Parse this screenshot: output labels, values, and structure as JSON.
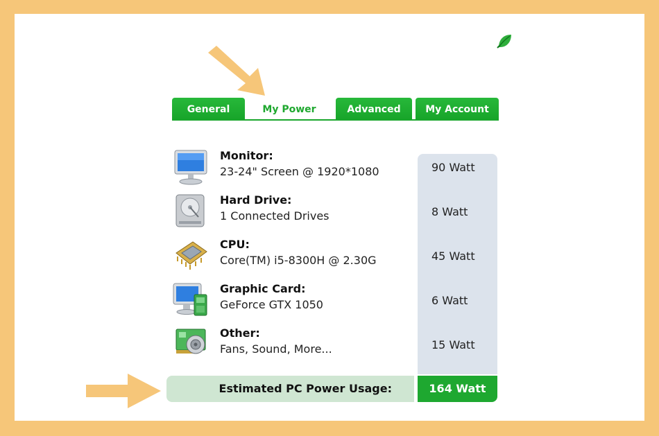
{
  "tabs": [
    {
      "label": "General"
    },
    {
      "label": "My Power"
    },
    {
      "label": "Advanced"
    },
    {
      "label": "My Account"
    }
  ],
  "rows": [
    {
      "title": "Monitor:",
      "detail": "23-24\" Screen @ 1920*1080",
      "watt": "90 Watt",
      "icon": "monitor-icon"
    },
    {
      "title": "Hard Drive:",
      "detail": "1 Connected Drives",
      "watt": "8 Watt",
      "icon": "hard-drive-icon"
    },
    {
      "title": "CPU:",
      "detail": "Core(TM) i5-8300H  @ 2.30G",
      "watt": "45 Watt",
      "icon": "cpu-icon"
    },
    {
      "title": "Graphic Card:",
      "detail": "GeForce GTX 1050",
      "watt": "6 Watt",
      "icon": "graphic-card-icon"
    },
    {
      "title": "Other:",
      "detail": "Fans, Sound, More...",
      "watt": "15 Watt",
      "icon": "sound-card-icon"
    }
  ],
  "summary": {
    "label": "Estimated PC Power Usage:",
    "value": "164 Watt"
  },
  "colors": {
    "frame": "#f6c679",
    "tab_green": "#1fa82f",
    "watt_column": "#dce3ec",
    "summary_label_bg": "#cfe6d2",
    "summary_value_bg": "#1ea830",
    "arrow": "#f6c679"
  },
  "icons": {
    "corner": "leaf-icon",
    "annotation": "arrow-icon"
  }
}
